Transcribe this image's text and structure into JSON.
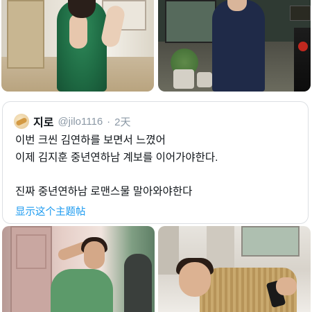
{
  "tweet": {
    "author_name": "지로",
    "handle": "@jilo1116",
    "separator": "·",
    "time": "2天",
    "lines": [
      "이번 크씬 김연하를 보면서 느꼈어",
      "이제 김지훈 중년연하남 계보를 이어가야한다.",
      "진짜 중년연하남 로맨스물 말아와야한다"
    ],
    "show_thread": "显示这个主题帖"
  },
  "colors": {
    "text": "#0f1419",
    "muted": "#8b98a5",
    "link": "#1d9bf0",
    "border": "#dcdfe3"
  }
}
